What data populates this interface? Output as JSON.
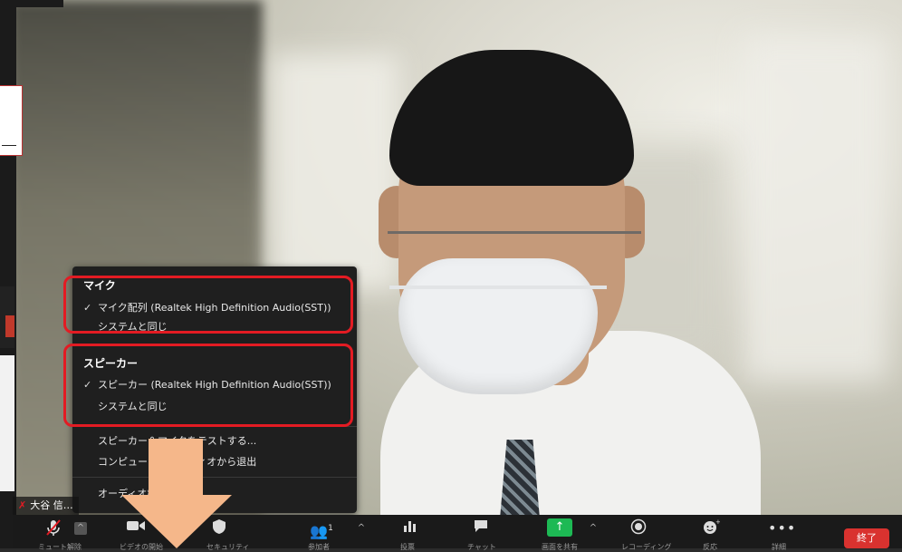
{
  "audio_menu": {
    "mic_header": "マイク",
    "mic_items": [
      "マイク配列 (Realtek High Definition Audio(SST))",
      "システムと同じ"
    ],
    "speaker_header": "スピーカー",
    "speaker_items": [
      "スピーカー (Realtek High Definition Audio(SST))",
      "システムと同じ"
    ],
    "test_label": "スピーカー＆マイクをテストする...",
    "leave_audio_label": "コンピューターオーディオから退出",
    "audio_settings_label": "オーディオ設定..."
  },
  "name_tag": {
    "name": "大谷 信… "
  },
  "toolbar": {
    "participants_count": "1",
    "end_label": "終了",
    "labels": {
      "mute": "ミュート解除",
      "video": "ビデオの開始",
      "security": "セキュリティ",
      "participants": "参加者",
      "polls": "投票",
      "chat": "チャット",
      "share": "画面を共有",
      "record": "レコーディング",
      "reactions": "反応",
      "more": "詳細"
    }
  },
  "colors": {
    "highlight": "#e31b23",
    "arrow": "#f5b78a",
    "end": "#d9322f",
    "share": "#1db954"
  }
}
